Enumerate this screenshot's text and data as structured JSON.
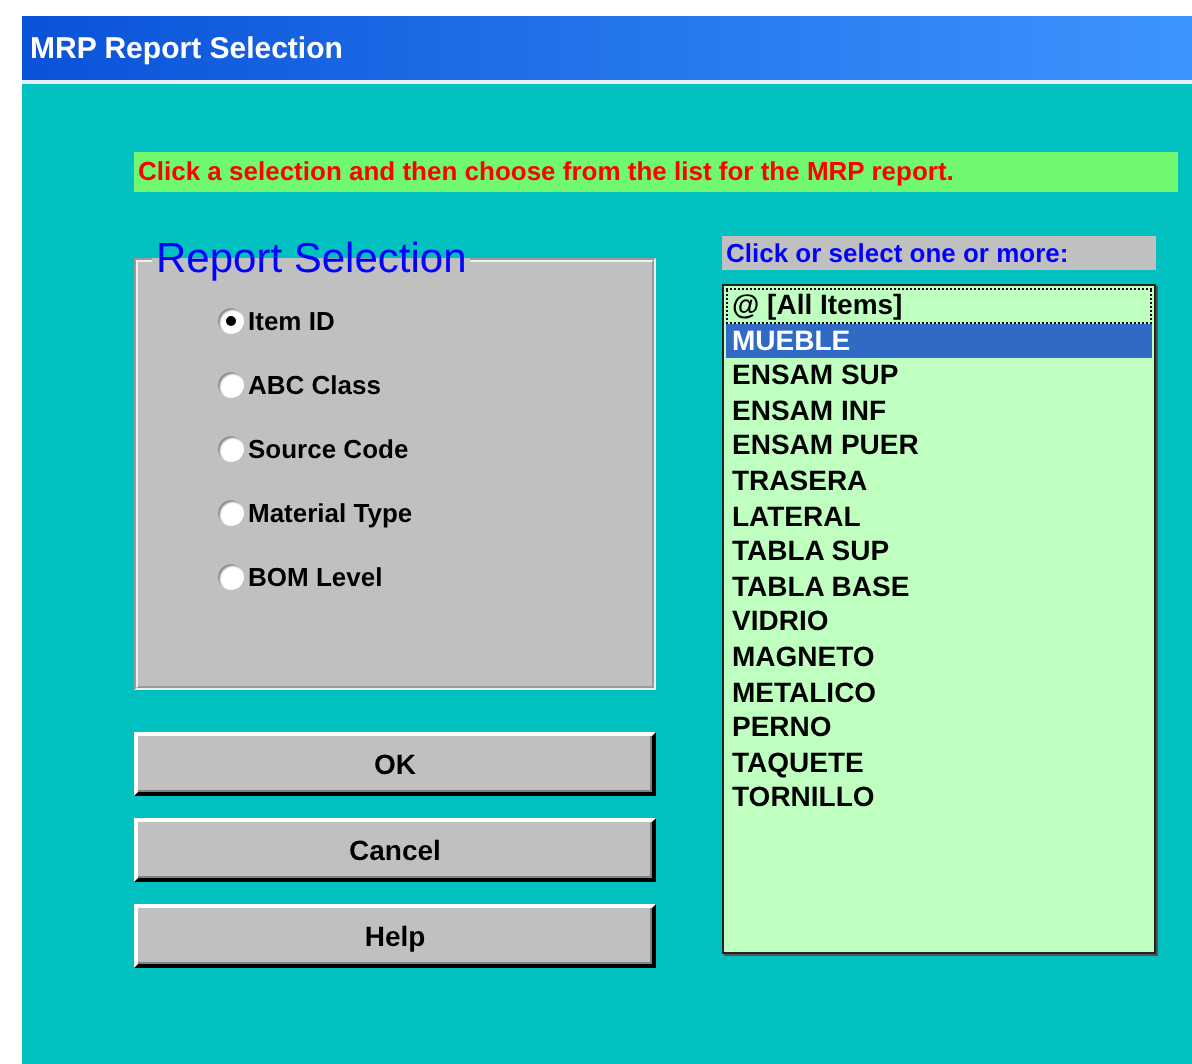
{
  "window": {
    "title": "MRP Report Selection"
  },
  "instruction": "Click a selection and then choose from the list for the MRP report.",
  "report_selection": {
    "title": "Report Selection",
    "options": [
      {
        "label": "Item ID",
        "selected": true
      },
      {
        "label": "ABC Class",
        "selected": false
      },
      {
        "label": "Source Code",
        "selected": false
      },
      {
        "label": "Material Type",
        "selected": false
      },
      {
        "label": "BOM Level",
        "selected": false
      }
    ]
  },
  "buttons": [
    "OK",
    "Cancel",
    "Help"
  ],
  "list": {
    "label": "Click or select one or more:",
    "items": [
      {
        "text": "@ [All Items]",
        "selected": false,
        "focused": true
      },
      {
        "text": "MUEBLE",
        "selected": true,
        "focused": false
      },
      {
        "text": "ENSAM SUP",
        "selected": false,
        "focused": false
      },
      {
        "text": "ENSAM INF",
        "selected": false,
        "focused": false
      },
      {
        "text": "ENSAM PUER",
        "selected": false,
        "focused": false
      },
      {
        "text": "TRASERA",
        "selected": false,
        "focused": false
      },
      {
        "text": "LATERAL",
        "selected": false,
        "focused": false
      },
      {
        "text": "TABLA SUP",
        "selected": false,
        "focused": false
      },
      {
        "text": "TABLA BASE",
        "selected": false,
        "focused": false
      },
      {
        "text": "VIDRIO",
        "selected": false,
        "focused": false
      },
      {
        "text": "MAGNETO",
        "selected": false,
        "focused": false
      },
      {
        "text": "METALICO",
        "selected": false,
        "focused": false
      },
      {
        "text": "PERNO",
        "selected": false,
        "focused": false
      },
      {
        "text": "TAQUETE",
        "selected": false,
        "focused": false
      },
      {
        "text": "TORNILLO",
        "selected": false,
        "focused": false
      }
    ]
  }
}
